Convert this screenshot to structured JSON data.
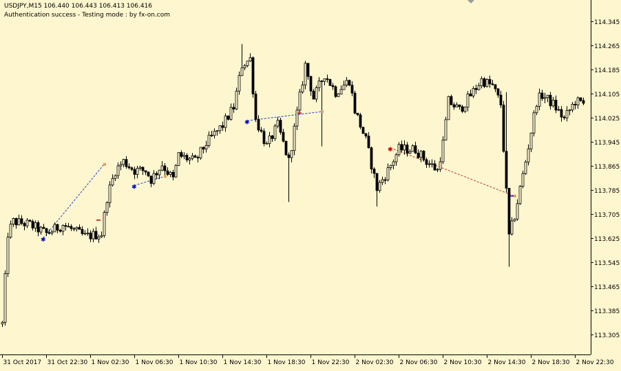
{
  "header": {
    "symbol_line": "USDJPY,M15  106.440 106.443 106.413 106.416",
    "status_line": "Authentication success - Testing mode : by fx-on.com"
  },
  "colors": {
    "background": "#FDF6CF",
    "candle": "#000000",
    "buy_arrow": "#0000CC",
    "sell_arrow": "#CC0000",
    "buy_trade_line": "#1F3FD6",
    "sell_trade_line": "#C0392B",
    "close_marker": "#E2A35C"
  },
  "chart_data": {
    "type": "candlestick",
    "grid": false,
    "y_axis_side": "right",
    "ylim": [
      113.265,
      114.385
    ],
    "y_ticks": [
      113.305,
      113.385,
      113.465,
      113.545,
      113.625,
      113.705,
      113.785,
      113.865,
      113.945,
      114.025,
      114.105,
      114.185,
      114.265,
      114.345
    ],
    "y_tick_labels": [
      "113.305",
      "113.385",
      "113.465",
      "113.545",
      "113.625",
      "113.705",
      "113.785",
      "113.865",
      "113.945",
      "114.025",
      "114.105",
      "114.185",
      "114.265",
      "114.345"
    ],
    "x_tick_labels": [
      "31 Oct 2017",
      "31 Oct 22:30",
      "1 Nov 02:30",
      "1 Nov 06:30",
      "1 Nov 10:30",
      "1 Nov 14:30",
      "1 Nov 18:30",
      "1 Nov 22:30",
      "2 Nov 02:30",
      "2 Nov 06:30",
      "2 Nov 10:30",
      "2 Nov 14:30",
      "2 Nov 18:30",
      "2 Nov 22:30"
    ],
    "bars_per_label": 16,
    "price_path": [
      [
        0,
        113.34
      ],
      [
        2,
        113.64
      ],
      [
        4,
        113.68
      ],
      [
        10,
        113.67
      ],
      [
        16,
        113.64
      ],
      [
        22,
        113.67
      ],
      [
        30,
        113.63
      ],
      [
        36,
        113.64
      ],
      [
        38,
        113.76
      ],
      [
        41,
        113.85
      ],
      [
        44,
        113.88
      ],
      [
        48,
        113.85
      ],
      [
        52,
        113.85
      ],
      [
        54,
        113.82
      ],
      [
        58,
        113.87
      ],
      [
        62,
        113.82
      ],
      [
        64,
        113.9
      ],
      [
        70,
        113.88
      ],
      [
        74,
        113.94
      ],
      [
        80,
        114.0
      ],
      [
        84,
        114.06
      ],
      [
        87,
        114.2
      ],
      [
        90,
        114.22
      ],
      [
        92,
        114.02
      ],
      [
        96,
        113.93
      ],
      [
        100,
        114.0
      ],
      [
        104,
        113.88
      ],
      [
        107,
        114.04
      ],
      [
        110,
        114.2
      ],
      [
        113,
        114.09
      ],
      [
        117,
        114.17
      ],
      [
        121,
        114.11
      ],
      [
        126,
        114.15
      ],
      [
        128,
        114.05
      ],
      [
        132,
        113.95
      ],
      [
        136,
        113.79
      ],
      [
        140,
        113.85
      ],
      [
        144,
        113.92
      ],
      [
        150,
        113.92
      ],
      [
        154,
        113.88
      ],
      [
        158,
        113.85
      ],
      [
        160,
        113.94
      ],
      [
        162,
        114.08
      ],
      [
        166,
        114.05
      ],
      [
        170,
        114.1
      ],
      [
        174,
        114.15
      ],
      [
        178,
        114.13
      ],
      [
        181,
        114.07
      ],
      [
        184,
        113.63
      ],
      [
        186,
        113.7
      ],
      [
        190,
        113.88
      ],
      [
        194,
        114.08
      ],
      [
        196,
        114.1
      ],
      [
        200,
        114.07
      ],
      [
        204,
        114.02
      ],
      [
        208,
        114.08
      ],
      [
        211,
        114.07
      ]
    ],
    "spikes": [
      {
        "bar": 184,
        "low": 113.53
      },
      {
        "bar": 183,
        "high": 114.11
      },
      {
        "bar": 104,
        "low": 113.745
      },
      {
        "bar": 116,
        "low": 113.93
      },
      {
        "bar": 136,
        "low": 113.73
      },
      {
        "bar": 0,
        "low": 113.34
      },
      {
        "bar": 87,
        "high": 114.27
      }
    ],
    "trades": [
      {
        "type": "buy",
        "entry_bar": 15,
        "entry_price": 113.625,
        "exit_bar": 37,
        "exit_price": 113.87,
        "exit_marker_bar": 35,
        "exit_marker_price": 113.685
      },
      {
        "type": "buy",
        "entry_bar": 48,
        "entry_price": 113.8,
        "exit_bar": 59,
        "exit_price": 113.83
      },
      {
        "type": "buy",
        "entry_bar": 89,
        "entry_price": 114.015,
        "exit_bar": 116,
        "exit_price": 114.045,
        "exit_marker_bar": 108,
        "exit_marker_price": 114.04
      },
      {
        "type": "sell",
        "entry_bar": 141,
        "entry_price": 113.925,
        "exit_bar": 186,
        "exit_price": 113.765,
        "exit_marker_bar": 185,
        "exit_marker_price": 113.765
      }
    ]
  }
}
